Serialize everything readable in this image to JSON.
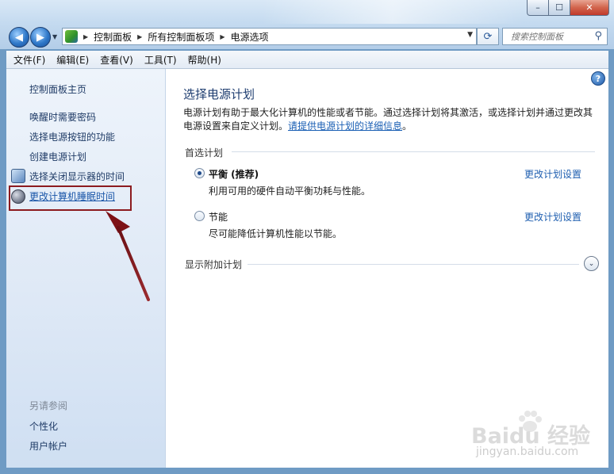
{
  "window": {
    "title_buttons": {
      "minimize": "–",
      "maximize": "☐",
      "close": "✕"
    }
  },
  "navigation": {
    "back_icon": "back-arrow-icon",
    "forward_icon": "forward-arrow-icon",
    "breadcrumbs": [
      "控制面板",
      "所有控制面板项",
      "电源选项"
    ],
    "search_placeholder": "搜索控制面板"
  },
  "menu": [
    "文件(F)",
    "编辑(E)",
    "查看(V)",
    "工具(T)",
    "帮助(H)"
  ],
  "sidebar": {
    "home": "控制面板主页",
    "tasks": [
      {
        "label": "唤醒时需要密码",
        "icon": ""
      },
      {
        "label": "选择电源按钮的功能",
        "icon": ""
      },
      {
        "label": "创建电源计划",
        "icon": ""
      },
      {
        "label": "选择关闭显示器的时间",
        "icon": "monitor-icon"
      },
      {
        "label": "更改计算机睡眠时间",
        "icon": "moon-icon",
        "highlighted": true
      }
    ],
    "see_also_heading": "另请参阅",
    "see_also": [
      "个性化",
      "用户帐户"
    ]
  },
  "main": {
    "title": "选择电源计划",
    "description": "电源计划有助于最大化计算机的性能或者节能。通过选择计划将其激活，或选择计划并通过更改其电源设置来自定义计划。",
    "description_link": "请提供电源计划的详细信息",
    "description_end": "。",
    "preferred_heading": "首选计划",
    "plans": [
      {
        "name": "平衡 (推荐)",
        "description": "利用可用的硬件自动平衡功耗与性能。",
        "selected": true,
        "link": "更改计划设置"
      },
      {
        "name": "节能",
        "description": "尽可能降低计算机性能以节能。",
        "selected": false,
        "link": "更改计划设置"
      }
    ],
    "additional_heading": "显示附加计划"
  },
  "watermark": {
    "logo": "Baidu 经验",
    "url": "jingyan.baidu.com"
  },
  "colors": {
    "highlight_box": "#8c1b1f",
    "link": "#1f5fb0",
    "title": "#1d3c6f"
  }
}
